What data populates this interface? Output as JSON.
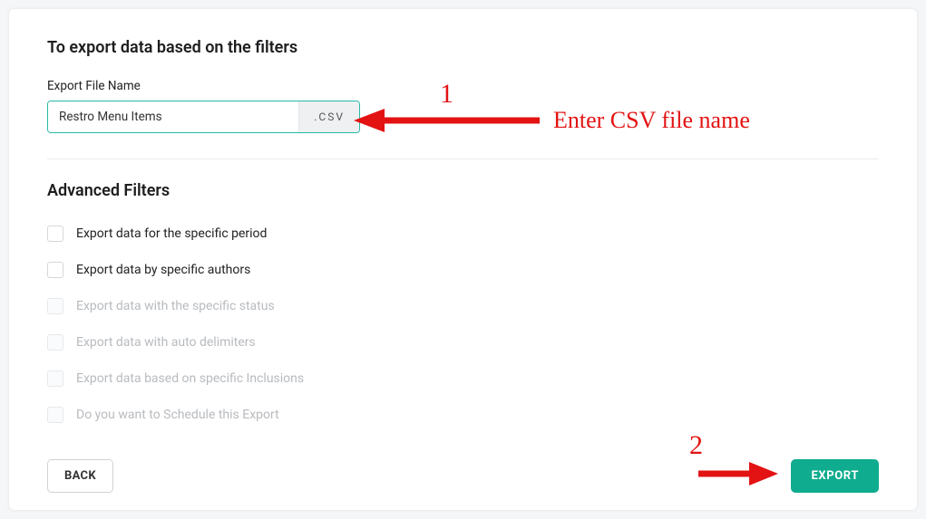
{
  "title": "To export data based on the filters",
  "fileName": {
    "label": "Export File Name",
    "value": "Restro Menu Items",
    "extension": ".CSV"
  },
  "advanced": {
    "heading": "Advanced Filters",
    "filters": [
      {
        "label": "Export data for the specific period",
        "enabled": true
      },
      {
        "label": "Export data by specific authors",
        "enabled": true
      },
      {
        "label": "Export data with the specific status",
        "enabled": false
      },
      {
        "label": "Export data with auto delimiters",
        "enabled": false
      },
      {
        "label": "Export data based on specific Inclusions",
        "enabled": false
      },
      {
        "label": "Do you want to Schedule this Export",
        "enabled": false
      }
    ]
  },
  "buttons": {
    "back": "BACK",
    "export": "EXPORT"
  },
  "annotations": {
    "num1": "1",
    "text1": "Enter CSV file name",
    "num2": "2",
    "arrowColor": "#e31313"
  }
}
